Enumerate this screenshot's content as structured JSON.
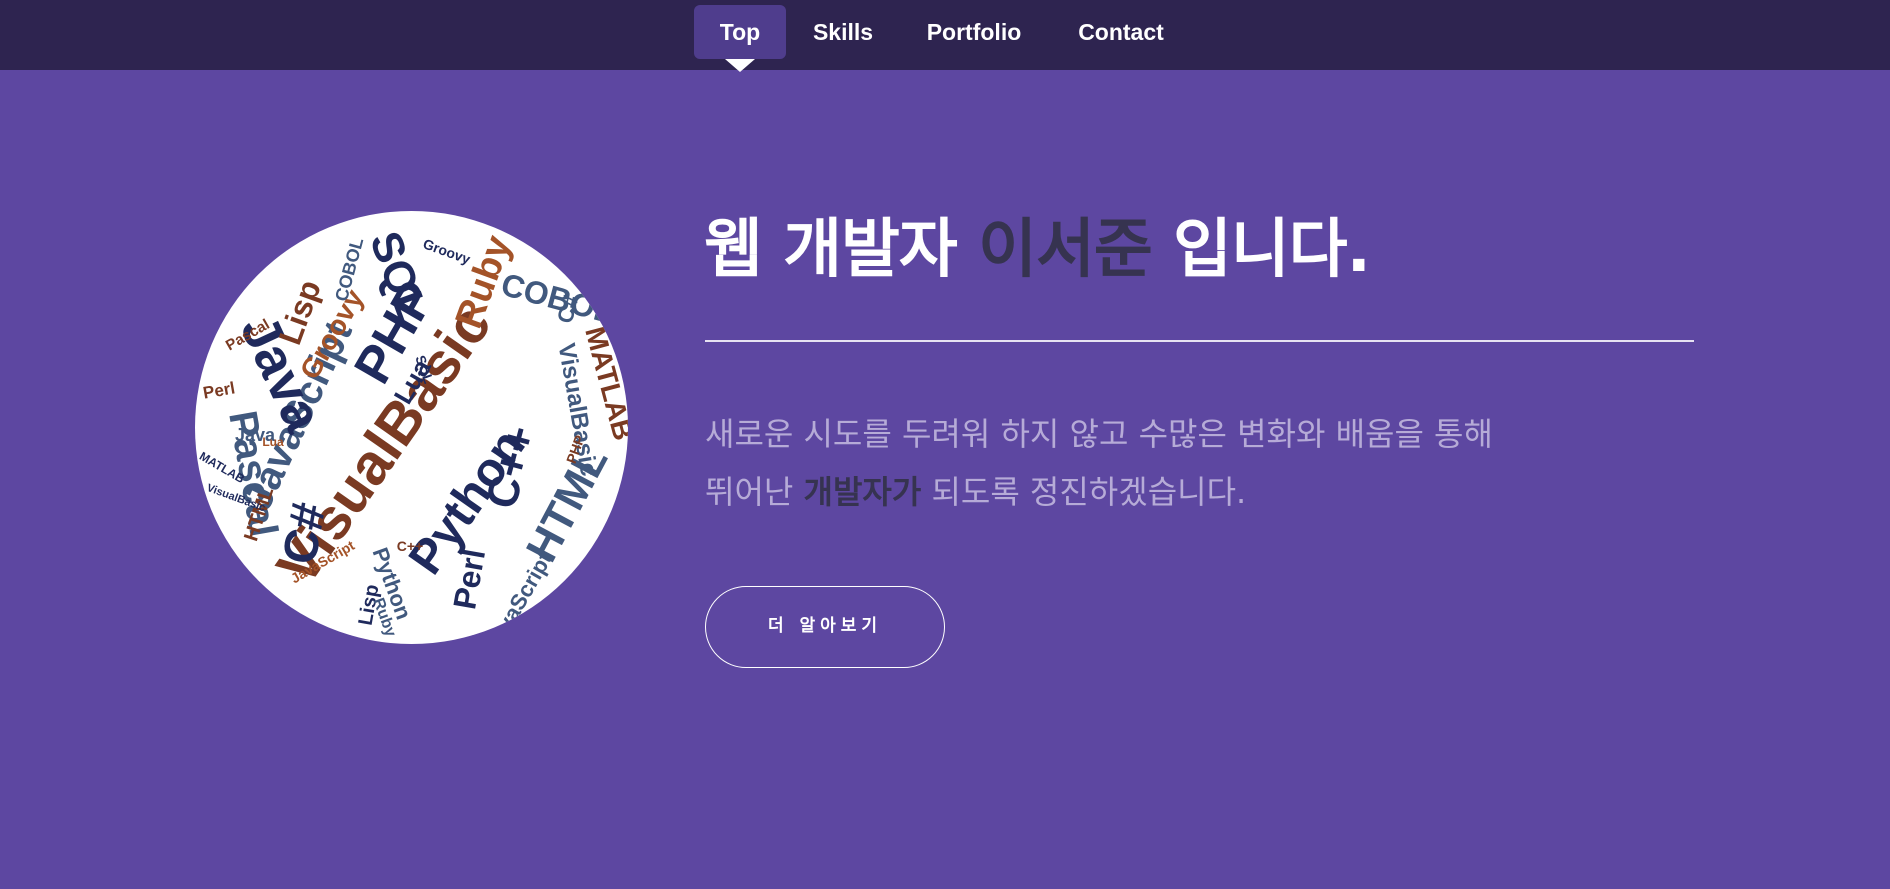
{
  "nav": {
    "items": [
      {
        "label": "Top",
        "active": true
      },
      {
        "label": "Skills",
        "active": false
      },
      {
        "label": "Portfolio",
        "active": false
      },
      {
        "label": "Contact",
        "active": false
      }
    ]
  },
  "hero": {
    "headline_before": "웹 개발자 ",
    "headline_name": "이서준",
    "headline_after": " 입니다.",
    "intro_line1": "새로운 시도를 두려워 하지 않고 수많은 변화와 배움을 통해",
    "intro_line2_before": "뛰어난 ",
    "intro_line2_emph": "개발자가",
    "intro_line2_after": " 되도록 정진하겠습니다.",
    "button_label": "더 알아보기"
  },
  "word_cloud": {
    "words": [
      "VisualBasic",
      "Python",
      "JavaScript",
      "Java",
      "PHP",
      "SQL",
      "C#",
      "C++",
      "HTML",
      "Pascal",
      "Ruby",
      "Lisp",
      "Groovy",
      "COBOL",
      "MATLAB",
      "Perl",
      "Lua"
    ]
  },
  "colors": {
    "background": "#5d47a1",
    "navbar": "#2e2450",
    "nav_active": "#4f3d8d",
    "accent_dark": "#363350",
    "intro_text": "#b6abd7",
    "word_navy": "#1f2a5c",
    "word_orange": "#a45328",
    "word_brown": "#7a3a22",
    "word_slate": "#41597e"
  }
}
